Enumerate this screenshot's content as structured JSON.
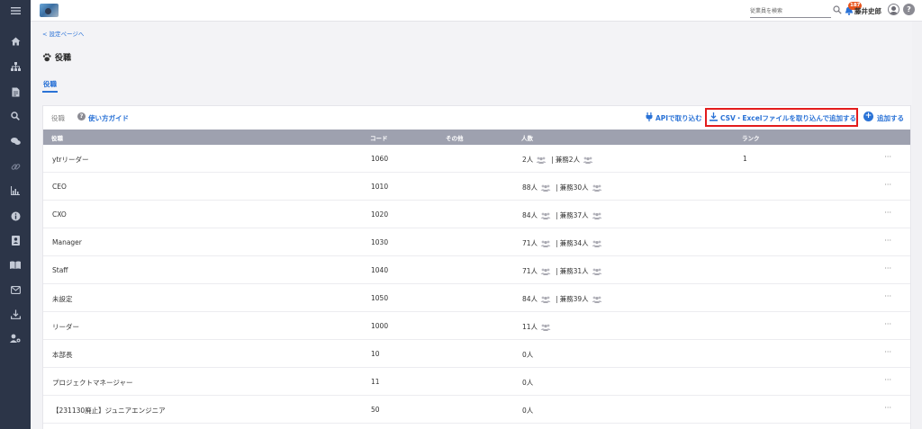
{
  "header": {
    "search_placeholder": "従業員を検索",
    "notification_count": "187",
    "user_name": "藤井史郎",
    "help_symbol": "?"
  },
  "page": {
    "back_link": "< 設定ページへ",
    "title": "役職",
    "tab": "役職"
  },
  "toolbar": {
    "title": "役職",
    "guide_label": "使い方ガイド",
    "api_label": "APIで取り込む",
    "csv_label": "CSV・Excelファイルを取り込んで追加する",
    "add_label": "追加する",
    "add_symbol": "+"
  },
  "table": {
    "columns": [
      "役職",
      "コード",
      "その他",
      "人数",
      "ランク"
    ],
    "more_label": "···",
    "rows": [
      {
        "name": "ytrリーダー",
        "code": "1060",
        "count": "2人",
        "concurrent": "兼務2人",
        "rank": "1"
      },
      {
        "name": "CEO",
        "code": "1010",
        "count": "88人",
        "concurrent": "兼務30人",
        "rank": ""
      },
      {
        "name": "CXO",
        "code": "1020",
        "count": "84人",
        "concurrent": "兼務37人",
        "rank": ""
      },
      {
        "name": "Manager",
        "code": "1030",
        "count": "71人",
        "concurrent": "兼務34人",
        "rank": ""
      },
      {
        "name": "Staff",
        "code": "1040",
        "count": "71人",
        "concurrent": "兼務31人",
        "rank": ""
      },
      {
        "name": "未設定",
        "code": "1050",
        "count": "84人",
        "concurrent": "兼務39人",
        "rank": ""
      },
      {
        "name": "リーダー",
        "code": "1000",
        "count": "11人",
        "concurrent": "",
        "rank": ""
      },
      {
        "name": "本部長",
        "code": "10",
        "count": "0人",
        "concurrent": "",
        "rank": ""
      },
      {
        "name": "プロジェクトマネージャー",
        "code": "11",
        "count": "0人",
        "concurrent": "",
        "rank": ""
      },
      {
        "name": "【231130廃止】ジュニアエンジニア",
        "code": "50",
        "count": "0人",
        "concurrent": "",
        "rank": ""
      }
    ]
  },
  "sidebar": {
    "icons": [
      "menu-icon",
      "home-icon",
      "org-chart-icon",
      "document-icon",
      "search-icon",
      "chat-icon",
      "link-icon",
      "chart-icon",
      "info-icon",
      "contact-card-icon",
      "book-icon",
      "mail-icon",
      "download-icon",
      "user-settings-icon"
    ]
  },
  "colors": {
    "accent": "#2a72d6",
    "sidebar": "#2c3548",
    "table_header": "#9ea1af",
    "highlight_border": "#e31c1c",
    "badge": "#e8551e"
  }
}
